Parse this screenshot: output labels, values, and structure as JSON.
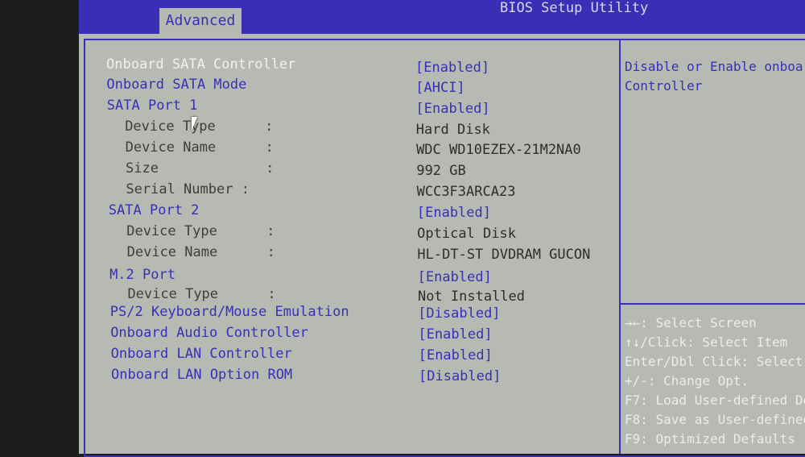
{
  "header": {
    "title": "BIOS Setup Utility",
    "tab": "Advanced"
  },
  "items": [
    {
      "label": "Onboard SATA Controller",
      "value": "[Enabled]",
      "kind": "option",
      "selected": true
    },
    {
      "label": "Onboard SATA Mode",
      "value": "[AHCI]",
      "kind": "option"
    },
    {
      "label": "SATA Port 1",
      "value": "[Enabled]",
      "kind": "option"
    },
    {
      "label": "Device Type      :",
      "value": "Hard Disk",
      "kind": "info"
    },
    {
      "label": "Device Name      :",
      "value": "WDC WD10EZEX-21M2NA0",
      "kind": "info"
    },
    {
      "label": "Size             :",
      "value": "992 GB",
      "kind": "info"
    },
    {
      "label": "Serial Number :",
      "value": "WCC3F3ARCA23",
      "kind": "info"
    },
    {
      "label": "SATA Port 2",
      "value": "[Enabled]",
      "kind": "option"
    },
    {
      "label": "Device Type      :",
      "value": "Optical Disk",
      "kind": "info"
    },
    {
      "label": "Device Name      :",
      "value": "HL-DT-ST DVDRAM GUCON",
      "kind": "info"
    },
    {
      "label": "M.2 Port",
      "value": "[Enabled]",
      "kind": "option"
    },
    {
      "label": "Device Type      :",
      "value": "Not Installed",
      "kind": "info"
    },
    {
      "label": "PS/2 Keyboard/Mouse Emulation",
      "value": "[Disabled]",
      "kind": "option"
    },
    {
      "label": "Onboard Audio Controller",
      "value": "[Enabled]",
      "kind": "option"
    },
    {
      "label": "Onboard LAN Controller",
      "value": "[Enabled]",
      "kind": "option"
    },
    {
      "label": "Onboard LAN Option ROM",
      "value": "[Disabled]",
      "kind": "option"
    }
  ],
  "help": [
    "Disable or Enable onboa",
    "Controller"
  ],
  "keys": [
    "→←: Select Screen",
    "↑↓/Click: Select Item",
    "Enter/Dbl Click: Select",
    "+/-: Change Opt.",
    "F7: Load User-defined De",
    "F8: Save as User-defined",
    "F9: Optimized Defaults"
  ]
}
